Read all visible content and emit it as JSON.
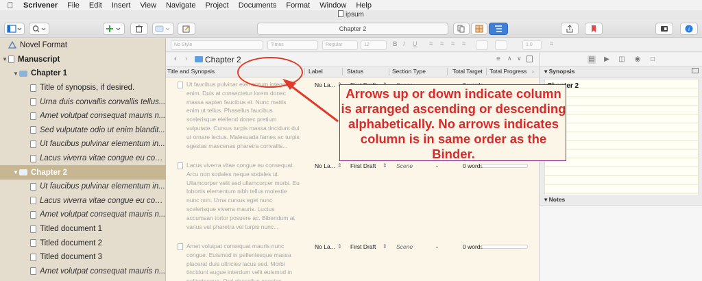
{
  "menubar": {
    "app": "Scrivener",
    "items": [
      "File",
      "Edit",
      "Insert",
      "View",
      "Navigate",
      "Project",
      "Documents",
      "Format",
      "Window",
      "Help"
    ]
  },
  "window": {
    "title": "ipsum"
  },
  "toolbar": {
    "document_title": "Chapter 2"
  },
  "formatbar": {
    "style": "No Style",
    "font": "Times",
    "weight": "Regular",
    "size": "12",
    "spacing": "1.0"
  },
  "binder": {
    "items": [
      {
        "label": "Novel Format",
        "level": 0,
        "kind": "format",
        "style": "normal"
      },
      {
        "label": "Manuscript",
        "level": 0,
        "kind": "doc",
        "style": "bold",
        "expanded": true
      },
      {
        "label": "Chapter 1",
        "level": 1,
        "kind": "folder",
        "style": "bold",
        "expanded": true
      },
      {
        "label": "Title of synopsis, if desired.",
        "level": 2,
        "kind": "doc",
        "style": "normal"
      },
      {
        "label": "Urna duis convallis convallis tellus...",
        "level": 2,
        "kind": "doc",
        "style": "italic"
      },
      {
        "label": "Amet volutpat consequat mauris n...",
        "level": 2,
        "kind": "doc",
        "style": "italic"
      },
      {
        "label": "Sed vulputate odio ut enim blandit...",
        "level": 2,
        "kind": "doc",
        "style": "italic"
      },
      {
        "label": "Ut faucibus pulvinar elementum in...",
        "level": 2,
        "kind": "doc",
        "style": "italic"
      },
      {
        "label": "Lacus viverra vitae congue eu con...",
        "level": 2,
        "kind": "doc",
        "style": "italic"
      },
      {
        "label": "Chapter 2",
        "level": 1,
        "kind": "folder",
        "style": "bold",
        "expanded": true,
        "selected": true
      },
      {
        "label": "Ut faucibus pulvinar elementum in...",
        "level": 2,
        "kind": "doc",
        "style": "italic"
      },
      {
        "label": "Lacus viverra vitae congue eu con...",
        "level": 2,
        "kind": "doc",
        "style": "italic"
      },
      {
        "label": "Amet volutpat consequat mauris n...",
        "level": 2,
        "kind": "doc",
        "style": "italic"
      },
      {
        "label": "Titled document 1",
        "level": 2,
        "kind": "doc",
        "style": "normal"
      },
      {
        "label": "Titled document 2",
        "level": 2,
        "kind": "doc",
        "style": "normal"
      },
      {
        "label": "Titled document 3",
        "level": 2,
        "kind": "doc",
        "style": "normal"
      },
      {
        "label": "Amet volutpat consequat mauris n...",
        "level": 2,
        "kind": "doc",
        "style": "italic"
      }
    ]
  },
  "editor": {
    "header_title": "Chapter 2",
    "columns": [
      "Title and Synopsis",
      "Label",
      "Status",
      "Section Type",
      "Total Target",
      "Total Progress"
    ],
    "rows": [
      {
        "synopsis": "Ut faucibus pulvinar elementum integer enim. Duis at consectetur lorem donec massa sapien faucibus et. Nunc mattis enim ut tellus. Phasellus faucibus scelerisque eleifend donec pretium vulputate. Cursus turpis massa tincidunt dui ut ornare lectus. Malesuada fames ac turpis egestas maecenas pharetra convallis...",
        "label": "No La...",
        "status": "First Draft",
        "section_type": "Scene",
        "total_target": "0 words"
      },
      {
        "synopsis": "Lacus viverra vitae congue eu consequat. Arcu non sodales neque sodales ut. Ullamcorper velit sed ullamcorper morbi. Eu lobortis elementum nibh tellus molestie nunc non. Urna cursus eget nunc scelerisque viverra mauris. Luctus accumsan tortor posuere ac. Bibendum at varius vel pharetra vel turpis nunc...",
        "label": "No La...",
        "status": "First Draft",
        "section_type": "Scene",
        "total_target": "0 words"
      },
      {
        "synopsis": "Amet volutpat consequat mauris nunc congue. Euismod in pellentesque massa placerat duis ultricies lacus sed. Morbi tincidunt augue interdum velit euismod in pellentesque. Orci phasellus egestas",
        "label": "No La...",
        "status": "First Draft",
        "section_type": "Scene",
        "total_target": "0 words"
      }
    ]
  },
  "inspector": {
    "synopsis_header": "Synopsis",
    "synopsis_title": "Chapter 2",
    "notes_header": "Notes"
  },
  "annotation": {
    "text": "Arrows up or down indicate column is arranged ascending or descending alphabetically. No arrows indicates column is in same order as the Binder.",
    "color": "#d82a2a"
  }
}
